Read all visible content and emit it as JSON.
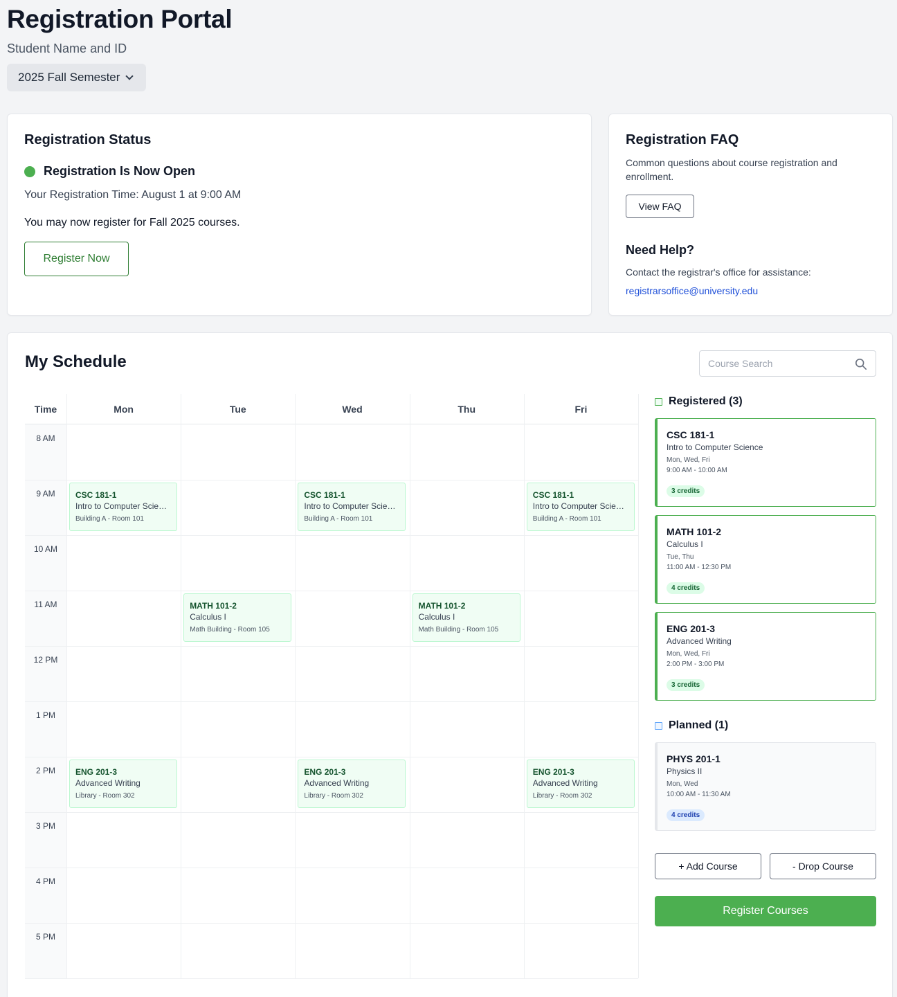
{
  "header": {
    "title": "Registration Portal",
    "student": "Student Name and ID",
    "semester": "2025 Fall Semester"
  },
  "status": {
    "title": "Registration Status",
    "state": "Registration Is Now Open",
    "status_color": "#4caf50",
    "time": "Your Registration Time: August 1 at 9:00 AM",
    "message": "You may now register for Fall 2025 courses.",
    "button": "Register Now"
  },
  "faq": {
    "title": "Registration FAQ",
    "desc": "Common questions about course registration and enrollment.",
    "button": "View FAQ",
    "help_title": "Need Help?",
    "help_desc": "Contact the registrar's office for assistance:",
    "email": "registrarsoffice@university.edu"
  },
  "schedule": {
    "title": "My Schedule",
    "search_placeholder": "Course Search",
    "time_header": "Time",
    "days": [
      "Mon",
      "Tue",
      "Wed",
      "Thu",
      "Fri"
    ],
    "times": [
      "8 AM",
      "9 AM",
      "10 AM",
      "11 AM",
      "12 PM",
      "1 PM",
      "2 PM",
      "3 PM",
      "4 PM",
      "5 PM"
    ],
    "events": [
      {
        "day": 0,
        "slot": 1,
        "code": "CSC 181-1",
        "name": "Intro to Computer Science",
        "loc": "Building A - Room 101"
      },
      {
        "day": 2,
        "slot": 1,
        "code": "CSC 181-1",
        "name": "Intro to Computer Science",
        "loc": "Building A - Room 101"
      },
      {
        "day": 4,
        "slot": 1,
        "code": "CSC 181-1",
        "name": "Intro to Computer Science",
        "loc": "Building A - Room 101"
      },
      {
        "day": 1,
        "slot": 3,
        "code": "MATH 101-2",
        "name": "Calculus I",
        "loc": "Math Building - Room 105"
      },
      {
        "day": 3,
        "slot": 3,
        "code": "MATH 101-2",
        "name": "Calculus I",
        "loc": "Math Building - Room 105"
      },
      {
        "day": 0,
        "slot": 6,
        "code": "ENG 201-3",
        "name": "Advanced Writing",
        "loc": "Library - Room 302"
      },
      {
        "day": 2,
        "slot": 6,
        "code": "ENG 201-3",
        "name": "Advanced Writing",
        "loc": "Library - Room 302"
      },
      {
        "day": 4,
        "slot": 6,
        "code": "ENG 201-3",
        "name": "Advanced Writing",
        "loc": "Library - Room 302"
      }
    ]
  },
  "sidebar": {
    "registered_title": "Registered (3)",
    "registered": [
      {
        "code": "CSC 181-1",
        "name": "Intro to Computer Science",
        "days": "Mon, Wed, Fri",
        "time": "9:00 AM - 10:00 AM",
        "credits": "3 credits"
      },
      {
        "code": "MATH 101-2",
        "name": "Calculus I",
        "days": "Tue, Thu",
        "time": "11:00 AM - 12:30 PM",
        "credits": "4 credits"
      },
      {
        "code": "ENG 201-3",
        "name": "Advanced Writing",
        "days": "Mon, Wed, Fri",
        "time": "2:00 PM - 3:00 PM",
        "credits": "3 credits"
      }
    ],
    "planned_title": "Planned (1)",
    "planned": [
      {
        "code": "PHYS 201-1",
        "name": "Physics II",
        "days": "Mon, Wed",
        "time": "10:00 AM - 11:30 AM",
        "credits": "4 credits"
      }
    ],
    "add_button": "+ Add Course",
    "drop_button": "- Drop Course",
    "register_button": "Register Courses"
  },
  "colors": {
    "accent": "#4caf50",
    "accent_dark": "#2e7d32",
    "link": "#1d4ed8",
    "planned": "#60a5fa"
  }
}
